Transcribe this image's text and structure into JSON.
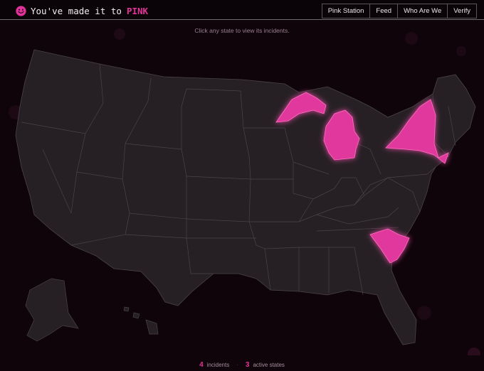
{
  "header": {
    "title_prefix": "You've made it to",
    "title_accent": "PINK",
    "nav": [
      {
        "label": "Pink Station"
      },
      {
        "label": "Feed"
      },
      {
        "label": "Who Are We"
      },
      {
        "label": "Verify"
      }
    ]
  },
  "map": {
    "hint": "Click any state to view its incidents.",
    "highlighted_states": [
      "Michigan",
      "New York",
      "South Carolina"
    ],
    "highlight_color": "#e0389c",
    "state_color": "#262024",
    "border_color": "#4a4348"
  },
  "footer": {
    "incidents_count": "4",
    "incidents_label": "incidents",
    "separator": "·",
    "states_count": "3",
    "states_label": "active states"
  },
  "colors": {
    "accent": "#e3339a",
    "background": "#0e0409"
  }
}
